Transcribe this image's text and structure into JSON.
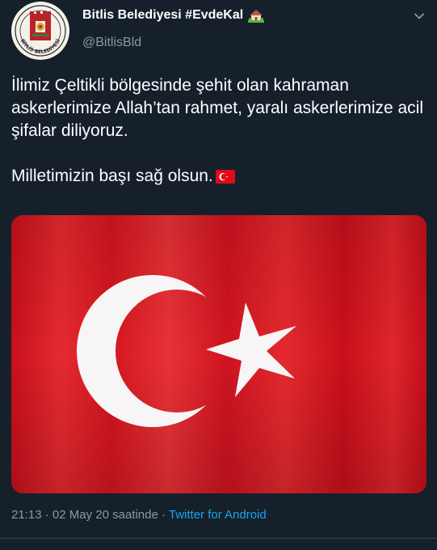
{
  "user": {
    "display_name": "Bitlis Belediyesi #EvdeKal",
    "handle": "@BitlisBld",
    "name_emoji_icon": "house-with-garden-icon",
    "avatar_icon": "bitlis-municipality-seal-icon",
    "avatar_seal_text": "BİTLİS BELEDİYESİ"
  },
  "tweet": {
    "line1": "İlimiz Çeltikli bölgesinde şehit olan kahraman askerlerimize Allah’tan rahmet, yaralı askerlerimize acil şifalar diliyoruz.",
    "line2": "Milletimizin başı sağ olsun.",
    "line2_emoji_icon": "turkey-flag-icon",
    "media_icon": "turkish-flag-image"
  },
  "meta": {
    "time": "21:13",
    "separator1": " · ",
    "date": "02 May 20 saatinde",
    "separator2": " · ",
    "source": "Twitter for Android"
  },
  "colors": {
    "background": "#15202b",
    "secondary_text": "#8899a6",
    "link": "#1da1f2",
    "flag_red": "#e30a17"
  },
  "icons": {
    "menu_caret": "chevron-down-icon"
  }
}
